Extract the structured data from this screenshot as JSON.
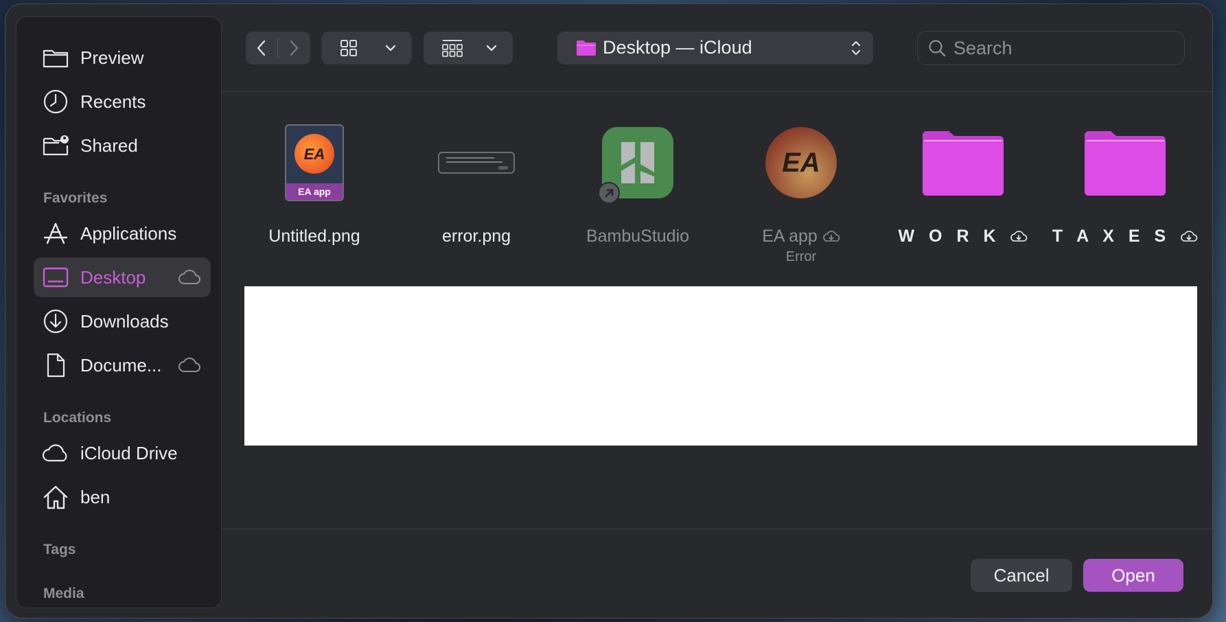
{
  "sidebar": {
    "items": [
      {
        "label": "Preview",
        "icon": "folder-icon"
      },
      {
        "label": "Recents",
        "icon": "clock-icon"
      },
      {
        "label": "Shared",
        "icon": "shared-folder-icon"
      },
      {
        "label": "Applications",
        "icon": "applications-icon"
      },
      {
        "label": "Desktop",
        "icon": "desktop-icon",
        "cloud": true,
        "selected": true
      },
      {
        "label": "Downloads",
        "icon": "download-icon"
      },
      {
        "label": "Docume...",
        "icon": "document-icon",
        "cloud": true
      },
      {
        "label": "iCloud Drive",
        "icon": "cloud-icon"
      },
      {
        "label": "ben",
        "icon": "home-icon"
      }
    ],
    "sections": {
      "favorites": "Favorites",
      "locations": "Locations",
      "tags": "Tags",
      "media": "Media"
    }
  },
  "toolbar": {
    "location": "Desktop — iCloud",
    "search_placeholder": "Search"
  },
  "files": [
    {
      "name": "Untitled.png",
      "badge": "EA app",
      "type": "image"
    },
    {
      "name": "error.png",
      "type": "image"
    },
    {
      "name": "BambuStudio",
      "type": "app-alias",
      "dimmed": true
    },
    {
      "name": "EA app",
      "sub": "Error",
      "type": "app",
      "dimmed": true,
      "cloud": true
    },
    {
      "name": "W O R K",
      "type": "folder",
      "cloud": true
    },
    {
      "name": "T A X E S",
      "type": "folder",
      "cloud": true
    }
  ],
  "buttons": {
    "cancel": "Cancel",
    "open": "Open"
  },
  "colors": {
    "accent": "#a453c1",
    "selected_label": "#c75fd6",
    "folder": "#d94be0",
    "dialog_bg": "#27292d"
  }
}
